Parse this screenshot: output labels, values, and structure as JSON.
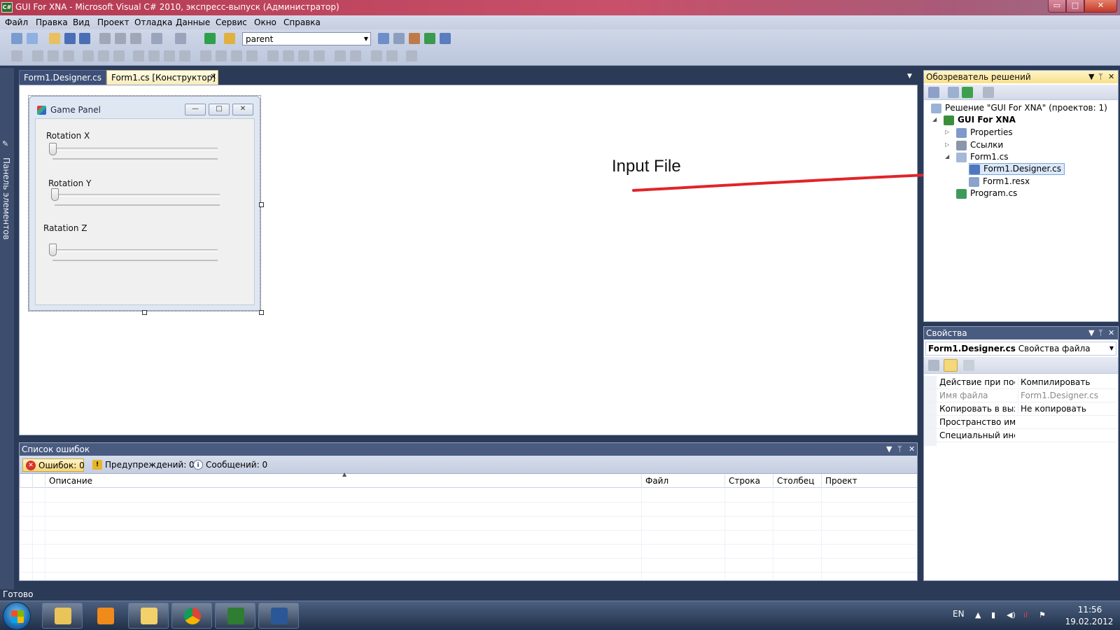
{
  "window": {
    "title": "GUI For XNA - Microsoft Visual C# 2010, экспресс-выпуск (Администратор)",
    "app_icon": "C#",
    "controls": {
      "minimize": "▭",
      "maximize": "□",
      "close": "✕"
    }
  },
  "menu": [
    "Файл",
    "Правка",
    "Вид",
    "Проект",
    "Отладка",
    "Данные",
    "Сервис",
    "Окно",
    "Справка"
  ],
  "toolbar": {
    "config_value": "parent"
  },
  "toolbox": {
    "label": "Панель элементов"
  },
  "tabs": [
    {
      "label": "Form1.Designer.cs",
      "active": false
    },
    {
      "label": "Form1.cs [Конструктор]",
      "active": true,
      "close": "✕"
    }
  ],
  "tab_dropdown": "▼",
  "form": {
    "title": "Game Panel",
    "buttons": {
      "min": "—",
      "max": "□",
      "close": "✕"
    },
    "labels": [
      "Rotation X",
      "Rotation Y",
      "Ratation Z"
    ]
  },
  "annotation": {
    "text": "Input File",
    "arrow_color": "#e0242a"
  },
  "error_list": {
    "title": "Список ошибок",
    "header_controls": [
      "▼",
      "ᛘ",
      "✕"
    ],
    "filters": {
      "errors": "Ошибок: 0",
      "warnings": "Предупреждений: 0",
      "messages": "Сообщений: 0"
    },
    "columns": [
      "Описание",
      "Файл",
      "Строка",
      "Столбец",
      "Проект"
    ],
    "sort_indicator": "▲"
  },
  "solution_explorer": {
    "title": "Обозреватель решений",
    "header_controls": [
      "▼",
      "ᛘ",
      "✕"
    ],
    "solution": "Решение \"GUI For XNA\"  (проектов: 1)",
    "project": "GUI For XNA",
    "items": [
      "Properties",
      "Ссылки",
      "Form1.cs",
      "Form1.Designer.cs",
      "Form1.resx",
      "Program.cs"
    ],
    "toggles": {
      "collapsed": "▷",
      "expanded": "◢"
    }
  },
  "properties": {
    "title": "Свойства",
    "header_controls": [
      "▼",
      "ᛘ",
      "✕"
    ],
    "object_name": "Form1.Designer.cs",
    "object_type": "Свойства файла",
    "rows": [
      {
        "key": "Действие при построении",
        "value": "Компилировать",
        "readonly": false
      },
      {
        "key": "Имя файла",
        "value": "Form1.Designer.cs",
        "readonly": true
      },
      {
        "key": "Копировать в выходной каталог",
        "value": "Не копировать",
        "readonly": false
      },
      {
        "key": "Пространство имен",
        "value": "",
        "readonly": false
      },
      {
        "key": "Специальный инструмент",
        "value": "",
        "readonly": false
      }
    ]
  },
  "status": {
    "text": "Готово"
  },
  "taskbar": {
    "language": "EN",
    "time": "11:56",
    "date": "19.02.2012",
    "tray_icons": [
      "▲",
      "▮",
      "◀)",
      "ıl",
      "⚑"
    ]
  },
  "colors": {
    "title_bar": "#c04a62",
    "ide_background": "#2b3a57",
    "active_tab": "#f8ecbb",
    "selected_node": "#dbe8fb"
  }
}
